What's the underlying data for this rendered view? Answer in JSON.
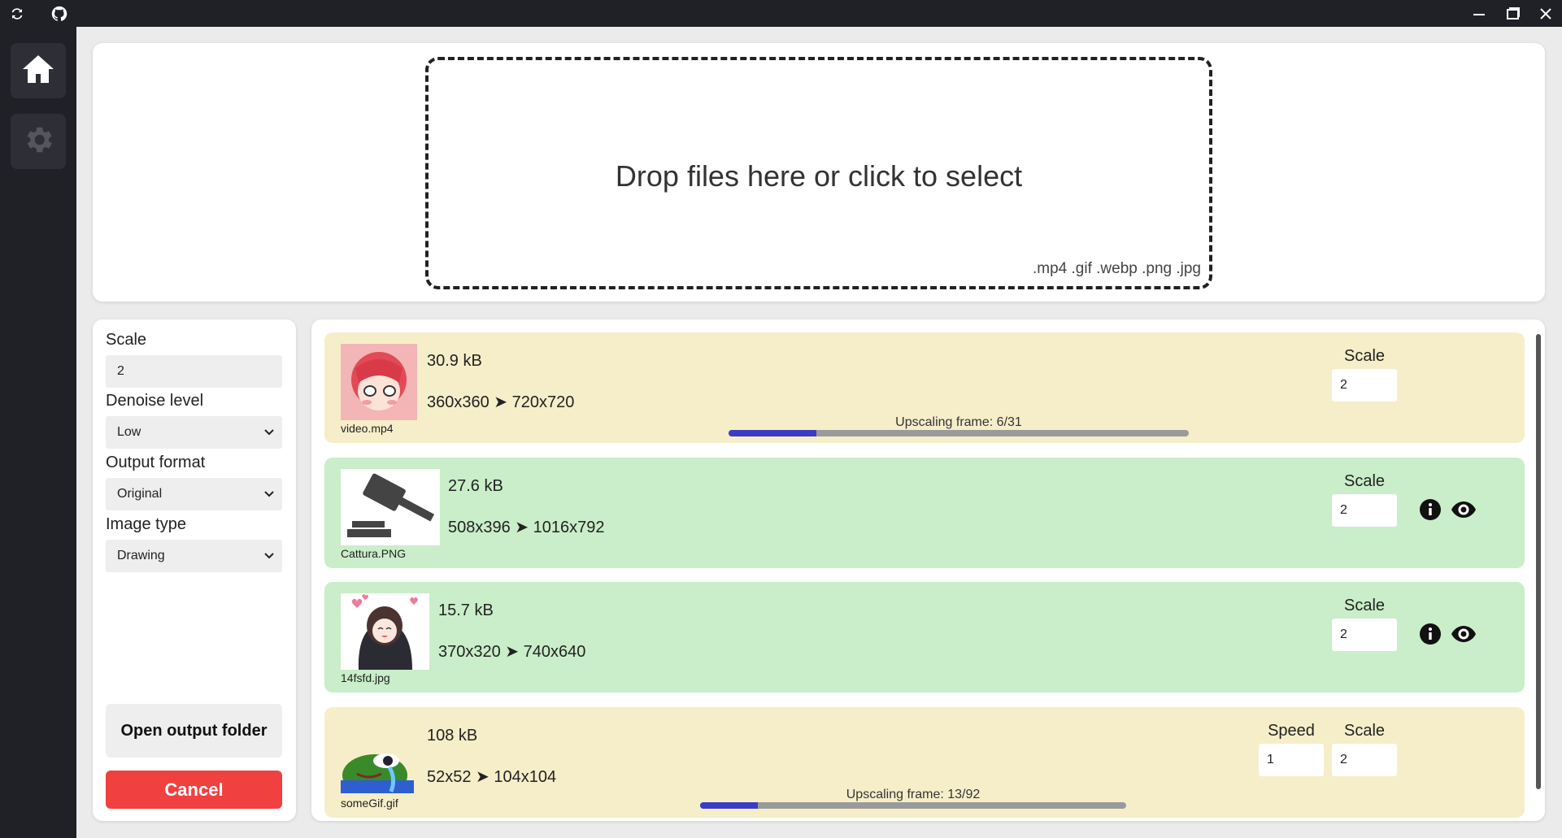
{
  "titlebar": {
    "icons": [
      "refresh-icon",
      "github-icon",
      "minimize-icon",
      "maximize-icon",
      "close-icon"
    ]
  },
  "sidebar": {
    "items": [
      {
        "icon": "home-icon",
        "active": true
      },
      {
        "icon": "gear-icon",
        "active": false
      }
    ]
  },
  "dropzone": {
    "text": "Drop files here or click to select",
    "extensions": ".mp4 .gif .webp .png .jpg"
  },
  "settings": {
    "scale_label": "Scale",
    "scale_value": "2",
    "denoise_label": "Denoise level",
    "denoise_value": "Low",
    "format_label": "Output format",
    "format_value": "Original",
    "image_type_label": "Image type",
    "image_type_value": "Drawing",
    "open_output_label": "Open output folder",
    "cancel_label": "Cancel"
  },
  "files": [
    {
      "name": "video.mp4",
      "size": "30.9 kB",
      "dims": "360x360 ➤ 720x720",
      "scale_label": "Scale",
      "scale": "2",
      "status_color": "#f6eec9",
      "progress_text": "Upscaling frame: 6/31",
      "progress_fraction": 0.19
    },
    {
      "name": "Cattura.PNG",
      "size": "27.6 kB",
      "dims": "508x396 ➤ 1016x792",
      "scale_label": "Scale",
      "scale": "2",
      "status_color": "#c9eec9",
      "icons": [
        "info-icon",
        "eye-icon"
      ]
    },
    {
      "name": "14fsfd.jpg",
      "size": "15.7 kB",
      "dims": "370x320 ➤ 740x640",
      "scale_label": "Scale",
      "scale": "2",
      "status_color": "#c9eec9",
      "icons": [
        "info-icon",
        "eye-icon"
      ]
    },
    {
      "name": "someGif.gif",
      "size": "108 kB",
      "dims": "52x52 ➤ 104x104",
      "speed_label": "Speed",
      "speed": "1",
      "scale_label": "Scale",
      "scale": "2",
      "status_color": "#f6eec9",
      "progress_text": "Upscaling frame: 13/92",
      "progress_fraction": 0.135
    }
  ]
}
